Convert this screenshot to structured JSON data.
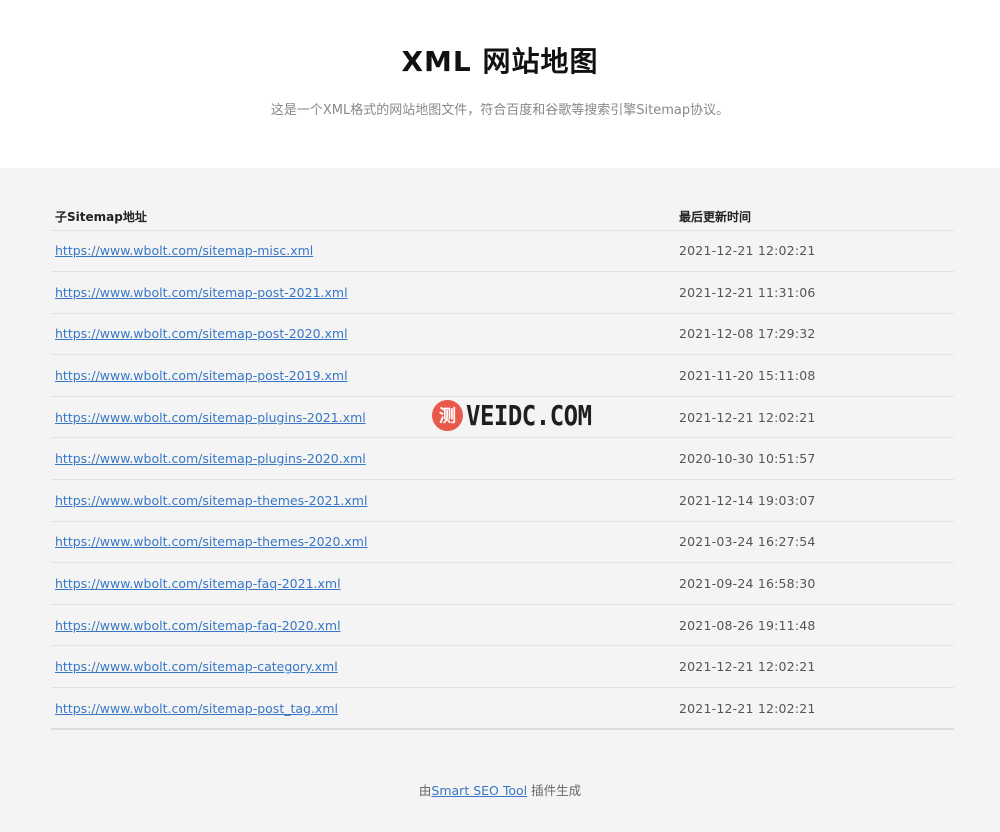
{
  "header": {
    "title": "XML 网站地图",
    "subtitle": "这是一个XML格式的网站地图文件，符合百度和谷歌等搜索引擎Sitemap协议。"
  },
  "table": {
    "columns": [
      "子Sitemap地址",
      "最后更新时间"
    ],
    "rows": [
      {
        "url": "https://www.wbolt.com/sitemap-misc.xml",
        "time": "2021-12-21 12:02:21"
      },
      {
        "url": "https://www.wbolt.com/sitemap-post-2021.xml",
        "time": "2021-12-21 11:31:06"
      },
      {
        "url": "https://www.wbolt.com/sitemap-post-2020.xml",
        "time": "2021-12-08 17:29:32"
      },
      {
        "url": "https://www.wbolt.com/sitemap-post-2019.xml",
        "time": "2021-11-20 15:11:08"
      },
      {
        "url": "https://www.wbolt.com/sitemap-plugins-2021.xml",
        "time": "2021-12-21 12:02:21"
      },
      {
        "url": "https://www.wbolt.com/sitemap-plugins-2020.xml",
        "time": "2020-10-30 10:51:57"
      },
      {
        "url": "https://www.wbolt.com/sitemap-themes-2021.xml",
        "time": "2021-12-14 19:03:07"
      },
      {
        "url": "https://www.wbolt.com/sitemap-themes-2020.xml",
        "time": "2021-03-24 16:27:54"
      },
      {
        "url": "https://www.wbolt.com/sitemap-faq-2021.xml",
        "time": "2021-09-24 16:58:30"
      },
      {
        "url": "https://www.wbolt.com/sitemap-faq-2020.xml",
        "time": "2021-08-26 19:11:48"
      },
      {
        "url": "https://www.wbolt.com/sitemap-category.xml",
        "time": "2021-12-21 12:02:21"
      },
      {
        "url": "https://www.wbolt.com/sitemap-post_tag.xml",
        "time": "2021-12-21 12:02:21"
      }
    ]
  },
  "watermark": {
    "badge_char": "测",
    "text": "VEIDC.COM"
  },
  "footer": {
    "prefix": "由",
    "link_text": "Smart SEO Tool",
    "suffix": " 插件生成"
  },
  "colors": {
    "link": "#3877c6",
    "badge": "#e8584b",
    "background": "#f4f4f4"
  }
}
